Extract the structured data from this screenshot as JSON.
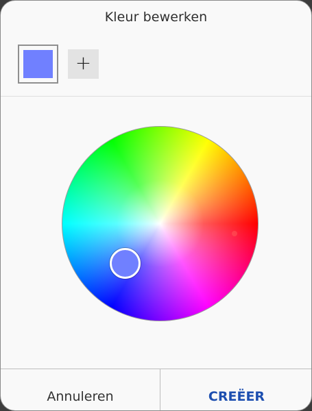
{
  "dialog": {
    "title": "Kleur bewerken"
  },
  "swatch": {
    "color": "#7080ff",
    "add_label": "+"
  },
  "picker": {
    "selected_color": "#7080ff",
    "hue_marker_color": "#ff5a5a"
  },
  "footer": {
    "cancel_label": "Annuleren",
    "create_label": "CREËER",
    "create_color": "#1d4fb0"
  }
}
